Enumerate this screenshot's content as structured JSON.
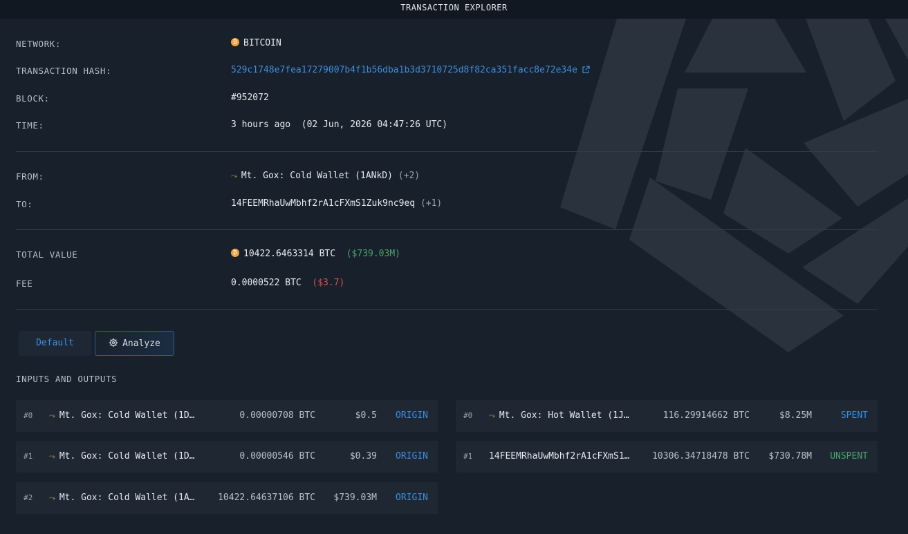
{
  "header": {
    "title": "TRANSACTION EXPLORER"
  },
  "summary": {
    "network_label": "NETWORK:",
    "network_value": "BITCOIN",
    "hash_label": "TRANSACTION HASH:",
    "hash_value": "529c1748e7fea17279007b4f1b56dba1b3d3710725d8f82ca351facc8e72e34e",
    "block_label": "BLOCK:",
    "block_value": "#952072",
    "time_label": "TIME:",
    "time_relative": "3 hours ago",
    "time_absolute": "(02 Jun, 2026 04:47:26 UTC)"
  },
  "parties": {
    "from_label": "FROM:",
    "from_value": "Mt. Gox: Cold Wallet (1ANkD)",
    "from_extra": "(+2)",
    "to_label": "TO:",
    "to_value": "14FEEMRhaUwMbhf2rA1cFXmS1Zuk9nc9eq",
    "to_extra": "(+1)"
  },
  "values": {
    "total_label": "TOTAL VALUE",
    "total_btc": "10422.6463314 BTC",
    "total_usd": "($739.03M)",
    "fee_label": "FEE",
    "fee_btc": "0.0000522 BTC",
    "fee_usd": "($3.7)"
  },
  "tabs": {
    "default": "Default",
    "analyze": "Analyze"
  },
  "io": {
    "title": "INPUTS AND OUTPUTS",
    "inputs": [
      {
        "index": "#0",
        "address": "Mt. Gox: Cold Wallet (1D…",
        "amount": "0.00000708 BTC",
        "usd": "$0.5",
        "status": "ORIGIN"
      },
      {
        "index": "#1",
        "address": "Mt. Gox: Cold Wallet (1D…",
        "amount": "0.00000546 BTC",
        "usd": "$0.39",
        "status": "ORIGIN"
      },
      {
        "index": "#2",
        "address": "Mt. Gox: Cold Wallet (1A…",
        "amount": "10422.64637106 BTC",
        "usd": "$739.03M",
        "status": "ORIGIN"
      }
    ],
    "outputs": [
      {
        "index": "#0",
        "address": "Mt. Gox: Hot Wallet (1J…",
        "amount": "116.29914662 BTC",
        "usd": "$8.25M",
        "status": "SPENT"
      },
      {
        "index": "#1",
        "address": "14FEEMRhaUwMbhf2rA1cFXmS1…",
        "amount": "10306.34718478 BTC",
        "usd": "$730.78M",
        "status": "UNSPENT"
      }
    ]
  },
  "colors": {
    "accent": "#3d8ede",
    "positive": "#4aa56b",
    "negative": "#d8504f",
    "btc": "#f2a03c"
  },
  "icons": {
    "network": "bitcoin-icon",
    "wallet": "wallet-tag-icon",
    "external": "external-link-icon",
    "analyze": "gear-icon"
  }
}
